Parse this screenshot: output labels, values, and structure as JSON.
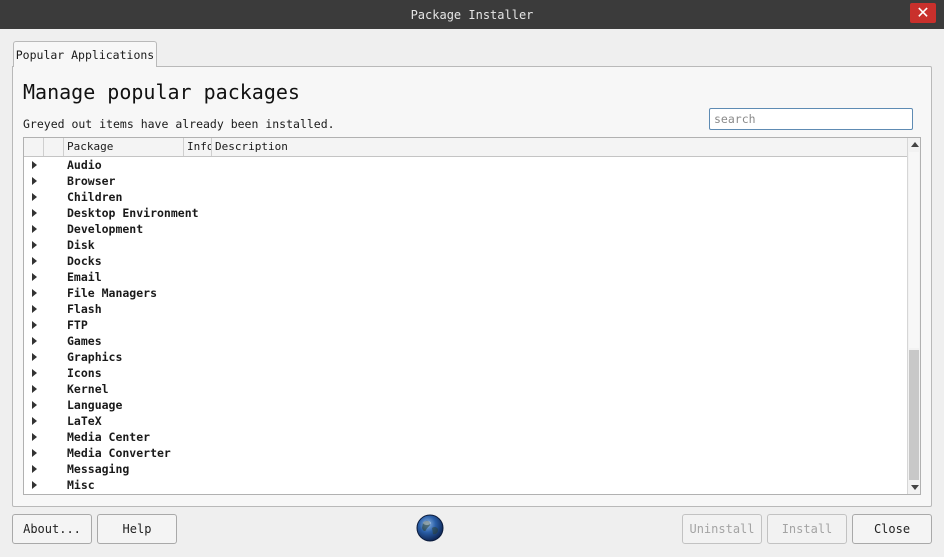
{
  "window": {
    "title": "Package Installer"
  },
  "tabs": [
    {
      "label": "Popular Applications"
    }
  ],
  "header": {
    "title": "Manage popular packages",
    "subtitle": "Greyed out items have already been installed."
  },
  "search": {
    "placeholder": "search",
    "value": ""
  },
  "table": {
    "columns": [
      "",
      "Package",
      "Info",
      "Description"
    ],
    "rows": [
      "Audio",
      "Browser",
      "Children",
      "Desktop Environment",
      "Development",
      "Disk",
      "Docks",
      "Email",
      "File Managers",
      "Flash",
      "FTP",
      "Games",
      "Graphics",
      "Icons",
      "Kernel",
      "Language",
      "LaTeX",
      "Media Center",
      "Media Converter",
      "Messaging",
      "Misc"
    ]
  },
  "buttons": {
    "about": "About...",
    "help": "Help",
    "uninstall": "Uninstall",
    "install": "Install",
    "close": "Close"
  },
  "icons": {
    "window_close": "close-icon",
    "expand": "triangle-right-icon",
    "app": "globe-icon"
  },
  "colors": {
    "titlebar": "#3b3b3b",
    "close_button": "#c9302c",
    "search_focus_border": "#5e8bb3"
  }
}
